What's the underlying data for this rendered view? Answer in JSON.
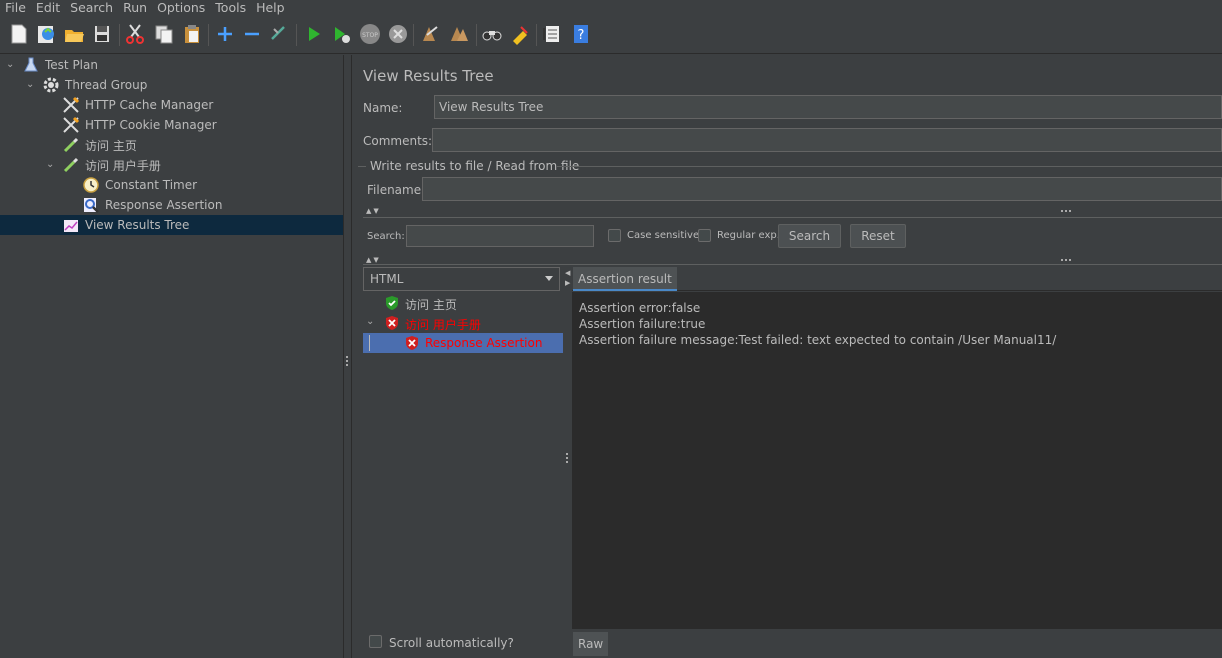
{
  "menu": [
    "File",
    "Edit",
    "Search",
    "Run",
    "Options",
    "Tools",
    "Help"
  ],
  "toolbar": {
    "buttons": [
      "new-icon",
      "templates-icon",
      "open-icon",
      "save-icon",
      "cut-icon",
      "copy-icon",
      "paste-icon",
      "expand-icon",
      "collapse-icon",
      "toggle-icon",
      "start-icon",
      "start-no-pause-icon",
      "stop-icon",
      "shutdown-icon",
      "clear-icon",
      "clear-all-icon",
      "search-icon",
      "reset-search-icon",
      "function-helper-icon",
      "help-icon"
    ]
  },
  "tree": {
    "items": [
      {
        "label": "Test Plan",
        "icon": "flask-icon"
      },
      {
        "label": "Thread Group",
        "icon": "gear-icon"
      },
      {
        "label": "HTTP Cache Manager",
        "icon": "wrench-icon"
      },
      {
        "label": "HTTP Cookie Manager",
        "icon": "wrench-icon"
      },
      {
        "label": "访问 主页",
        "icon": "pipette-icon"
      },
      {
        "label": "访问 用户手册",
        "icon": "pipette-icon"
      },
      {
        "label": "Constant Timer",
        "icon": "timer-icon"
      },
      {
        "label": "Response Assertion",
        "icon": "magnifier-icon"
      },
      {
        "label": "View Results Tree",
        "icon": "graph-icon"
      }
    ]
  },
  "panel": {
    "title": "View Results Tree",
    "name_label": "Name:",
    "name_value": "View Results Tree",
    "comments_label": "Comments:",
    "comments_value": "",
    "file_section_title": "Write results to file / Read from file",
    "filename_label": "Filename",
    "filename_value": "",
    "search_label": "Search:",
    "search_value": "",
    "case_sensitive_label": "Case sensitive",
    "regex_label": "Regular exp.",
    "search_button": "Search",
    "reset_button": "Reset"
  },
  "results": {
    "renderer": "HTML",
    "samples": [
      {
        "label": "访问 主页",
        "status": "pass",
        "color": "#bbbbbb"
      },
      {
        "label": "访问 用户手册",
        "status": "fail",
        "color": "#ff0000"
      },
      {
        "label": "Response Assertion",
        "status": "fail",
        "color": "#ff0000"
      }
    ],
    "tab_label": "Assertion result",
    "lines": [
      "Assertion error:false",
      "Assertion failure:true",
      "Assertion failure message:Test failed: text expected to contain /User Manual11/"
    ],
    "raw_tab": "Raw",
    "scroll_label": "Scroll automatically?"
  },
  "colors": {
    "background": "#3c3f41",
    "selection": "#0d293e",
    "result_selection": "#4b6eaf",
    "error": "#ff0000"
  }
}
